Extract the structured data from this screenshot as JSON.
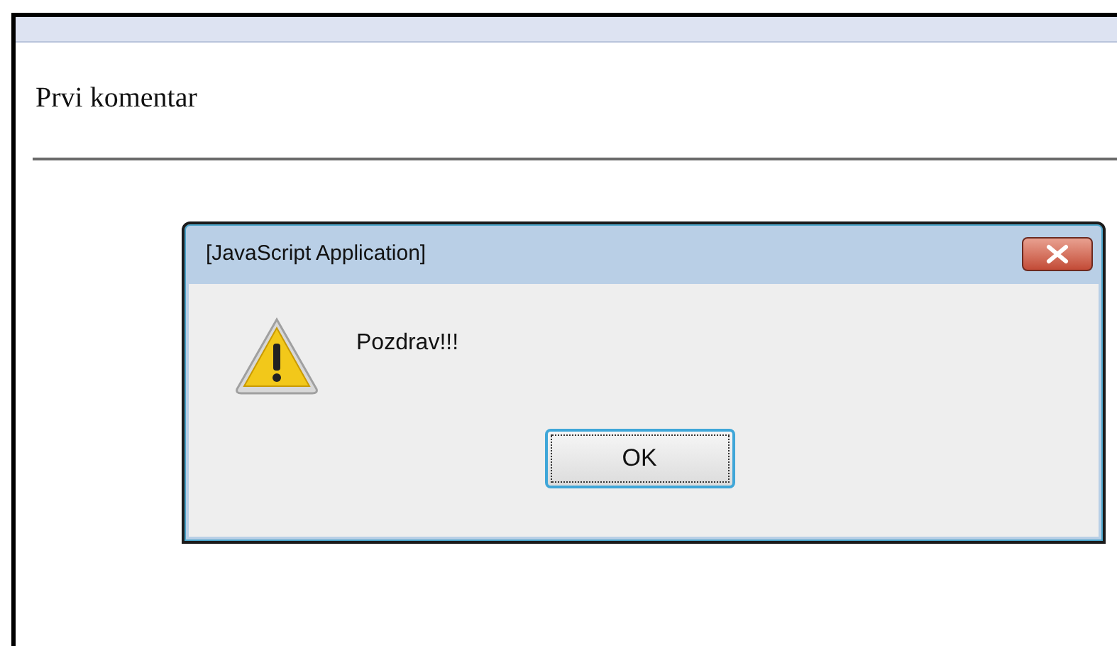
{
  "page": {
    "heading": "Prvi komentar"
  },
  "dialog": {
    "title": "[JavaScript Application]",
    "message": "Pozdrav!!!",
    "kind": "warning",
    "buttons": [
      {
        "label": "OK",
        "focused": true
      }
    ]
  }
}
